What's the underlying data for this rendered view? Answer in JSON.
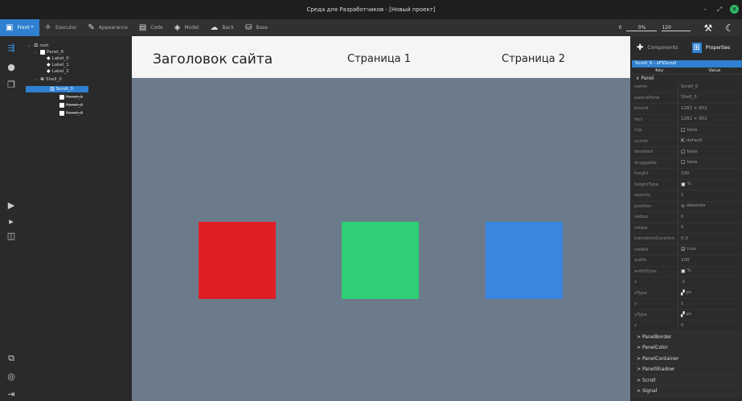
{
  "window": {
    "title": "Среда для Разработчиков - [Новый проект]"
  },
  "toolbar": {
    "tabs": [
      {
        "label": "Front *",
        "icon": "layout-icon"
      },
      {
        "label": "Executor",
        "icon": "wand-icon"
      },
      {
        "label": "Appearance",
        "icon": "palette-icon"
      },
      {
        "label": "Code",
        "icon": "code-file-icon"
      },
      {
        "label": "Model",
        "icon": "layers-icon"
      },
      {
        "label": "Back",
        "icon": "cloud-icon"
      },
      {
        "label": "Base",
        "icon": "database-icon"
      }
    ],
    "zoom_min": "0",
    "zoom_percent": "0%",
    "zoom_max": "120"
  },
  "tree": {
    "nodes": [
      {
        "label": "root"
      },
      {
        "label": "Panel_6"
      },
      {
        "label": "Label_0"
      },
      {
        "label": "Label_1"
      },
      {
        "label": "Label_2"
      },
      {
        "label": "Shell_0"
      },
      {
        "label": "Scroll_0"
      },
      {
        "label": "Panel_1"
      },
      {
        "label": "Panel_2"
      },
      {
        "label": "Panel_3"
      }
    ]
  },
  "canvas": {
    "site_title": "Заголовок сайта",
    "link1": "Страница 1",
    "link2": "Страница 2",
    "colors": {
      "red": "#e01e25",
      "green": "#2ecf75",
      "blue": "#3a86e0",
      "background": "#6b7b8c"
    }
  },
  "panel": {
    "tabs": {
      "components": "Components",
      "properties": "Properties"
    },
    "path": "Scroll_0 - sFSScroll",
    "head_key": "Key",
    "head_value": "Value",
    "group": "Panel",
    "props": [
      {
        "key": "name",
        "value": "Scroll_0"
      },
      {
        "key": "parentPane",
        "value": "Shell_0"
      },
      {
        "key": "bound",
        "value": "1282 × 952"
      },
      {
        "key": "fact",
        "value": "1282 × 952"
      },
      {
        "key": "clip",
        "value": "false",
        "icon": "☐"
      },
      {
        "key": "cursor",
        "value": "default",
        "icon": "⇱"
      },
      {
        "key": "disabled",
        "value": "false",
        "icon": "☐"
      },
      {
        "key": "draggable",
        "value": "false",
        "icon": "☐"
      },
      {
        "key": "height",
        "value": "100"
      },
      {
        "key": "heightType",
        "value": "%",
        "icon": "▣"
      },
      {
        "key": "opacity",
        "value": "1"
      },
      {
        "key": "position",
        "value": "absolute",
        "icon": "⊹"
      },
      {
        "key": "radius",
        "value": "0"
      },
      {
        "key": "rotate",
        "value": "0"
      },
      {
        "key": "transitionDuration",
        "value": "0.3"
      },
      {
        "key": "visible",
        "value": "true",
        "icon": "☑"
      },
      {
        "key": "width",
        "value": "100"
      },
      {
        "key": "widthType",
        "value": "%",
        "icon": "▣"
      },
      {
        "key": "x",
        "value": "-1"
      },
      {
        "key": "xType",
        "value": "px",
        "icon": "▞"
      },
      {
        "key": "y",
        "value": "1"
      },
      {
        "key": "yType",
        "value": "px",
        "icon": "▞"
      },
      {
        "key": "z",
        "value": "0"
      }
    ],
    "sections": [
      "PanelBorder",
      "PanelColor",
      "PanelContainer",
      "PanelShadow",
      "Scroll",
      "Signal"
    ]
  }
}
